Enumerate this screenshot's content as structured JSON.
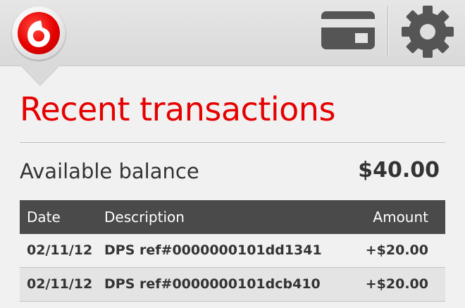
{
  "header": {
    "logo_icon": "vodafone-speechmark-logo",
    "card_icon": "credit-card-icon",
    "settings_icon": "gear-icon",
    "brand_color": "#e60000"
  },
  "page": {
    "title": "Recent transactions"
  },
  "balance": {
    "label": "Available balance",
    "value": "$40.00"
  },
  "table": {
    "columns": {
      "date": "Date",
      "description": "Description",
      "amount": "Amount"
    },
    "rows": [
      {
        "date": "02/11/12",
        "description": "DPS ref#0000000101dd1341",
        "amount": "+$20.00"
      },
      {
        "date": "02/11/12",
        "description": "DPS ref#0000000101dcb410",
        "amount": "+$20.00"
      }
    ]
  }
}
